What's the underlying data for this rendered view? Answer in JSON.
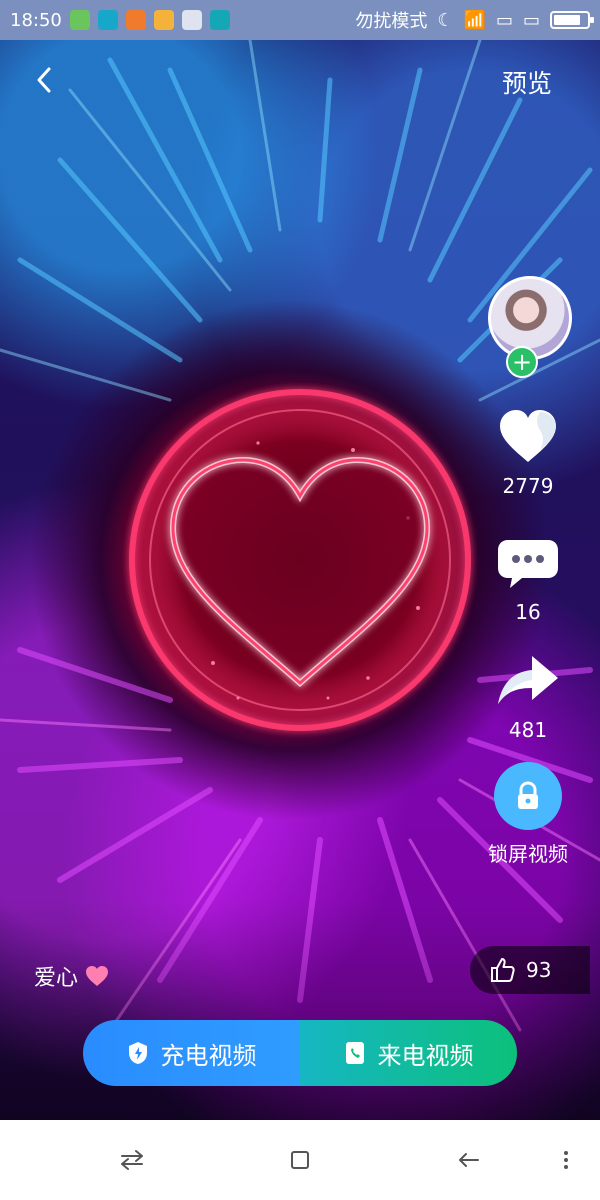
{
  "status_bar": {
    "time": "18:50",
    "dnd_label": "勿扰模式",
    "battery_level": 0.8
  },
  "top_bar": {
    "preview_label": "预览"
  },
  "right_rail": {
    "likes": "2779",
    "comments": "16",
    "shares": "481",
    "lock_label": "锁屏视频"
  },
  "video": {
    "title": "爱心"
  },
  "like_pill": {
    "count": "93"
  },
  "cta": {
    "charge_label": "充电视频",
    "call_label": "来电视频"
  },
  "icons": {
    "back": "chevron-left-icon",
    "heart": "heart-icon",
    "comment": "chat-bubble-icon",
    "share": "share-arrow-icon",
    "lock": "lock-icon",
    "thumb": "thumbs-up-icon",
    "shield": "shield-icon",
    "phone": "phone-card-icon",
    "nav_menu": "swap-arrows-icon",
    "nav_home": "square-icon",
    "nav_back": "back-arrow-icon",
    "nav_more": "more-icon"
  },
  "colors": {
    "status_bar": "#7b90bf",
    "cta_left": "#2a8cff",
    "cta_right": "#0cc07a",
    "lock": "#49b8ff",
    "avatar_add": "#29c068"
  }
}
